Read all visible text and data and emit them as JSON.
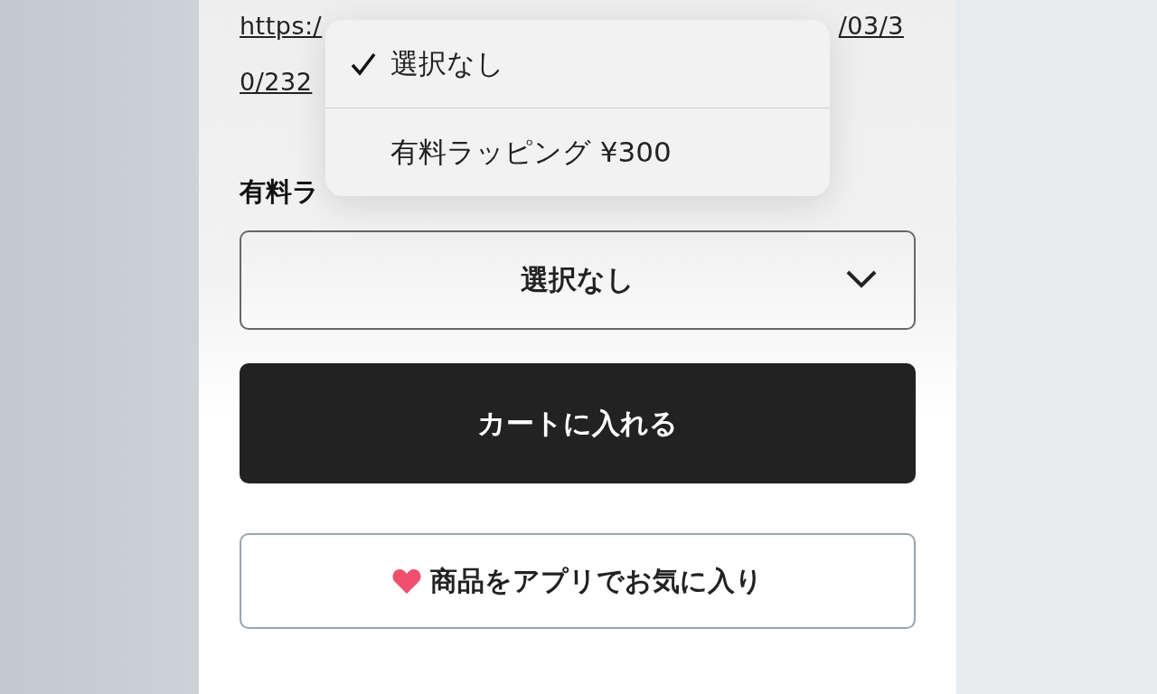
{
  "link_lines": [
    [
      "https:/",
      "/03/3"
    ],
    [
      "0/232"
    ]
  ],
  "wrapping_label": "有料ラ",
  "wrapping_select": {
    "value": "選択なし",
    "expanded": true
  },
  "dropdown_options": [
    {
      "label": "選択なし",
      "selected": true
    },
    {
      "label": "有料ラッピング ¥300",
      "selected": false
    }
  ],
  "cart_button": "カートに入れる",
  "favorite_button": "商品をアプリでお気に入り"
}
